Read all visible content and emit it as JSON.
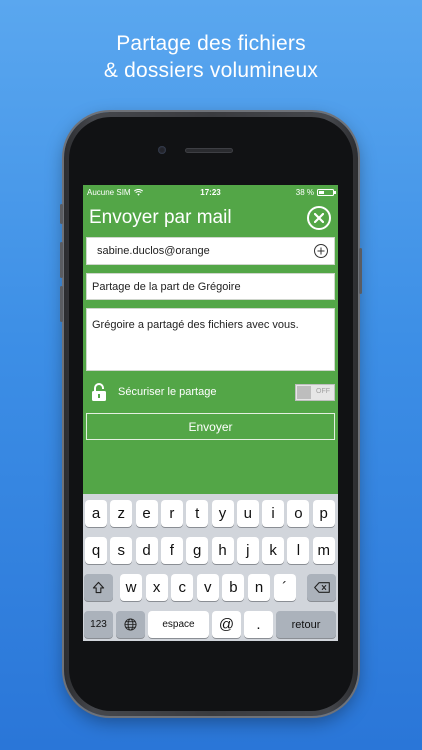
{
  "headline": {
    "line1": "Partage des fichiers",
    "line2": "& dossiers volumineux"
  },
  "status_bar": {
    "carrier": "Aucune SIM",
    "time": "17:23",
    "battery": "38 %",
    "battery_level": 0.38,
    "icons": [
      "wifi-icon",
      "battery-icon"
    ]
  },
  "navbar": {
    "title": "Envoyer par mail",
    "close_icon": "close-icon"
  },
  "form": {
    "to_value": "sabine.duclos@orange",
    "add_icon": "plus-circle-icon",
    "subject_value": "Partage de la part de Grégoire",
    "body_value": "Grégoire a partagé des fichiers avec vous.",
    "secure_label": "Sécuriser le partage",
    "lock_icon": "lock-icon",
    "toggle_state": "OFF",
    "send_label": "Envoyer"
  },
  "keyboard": {
    "row1": [
      "a",
      "z",
      "e",
      "r",
      "t",
      "y",
      "u",
      "i",
      "o",
      "p"
    ],
    "row2": [
      "q",
      "s",
      "d",
      "f",
      "g",
      "h",
      "j",
      "k",
      "l",
      "m"
    ],
    "row3": [
      "w",
      "x",
      "c",
      "v",
      "b",
      "n",
      "´"
    ],
    "shift_icon": "shift-icon",
    "delete_icon": "backspace-icon",
    "numbers_label": "123",
    "globe_icon": "globe-icon",
    "space_label": "espace",
    "at_label": "@",
    "dot_label": ".",
    "return_label": "retour"
  },
  "colors": {
    "app_green": "#53a647",
    "background_blue": "#3d8fe6",
    "keyboard_bg": "#d1d5db"
  }
}
